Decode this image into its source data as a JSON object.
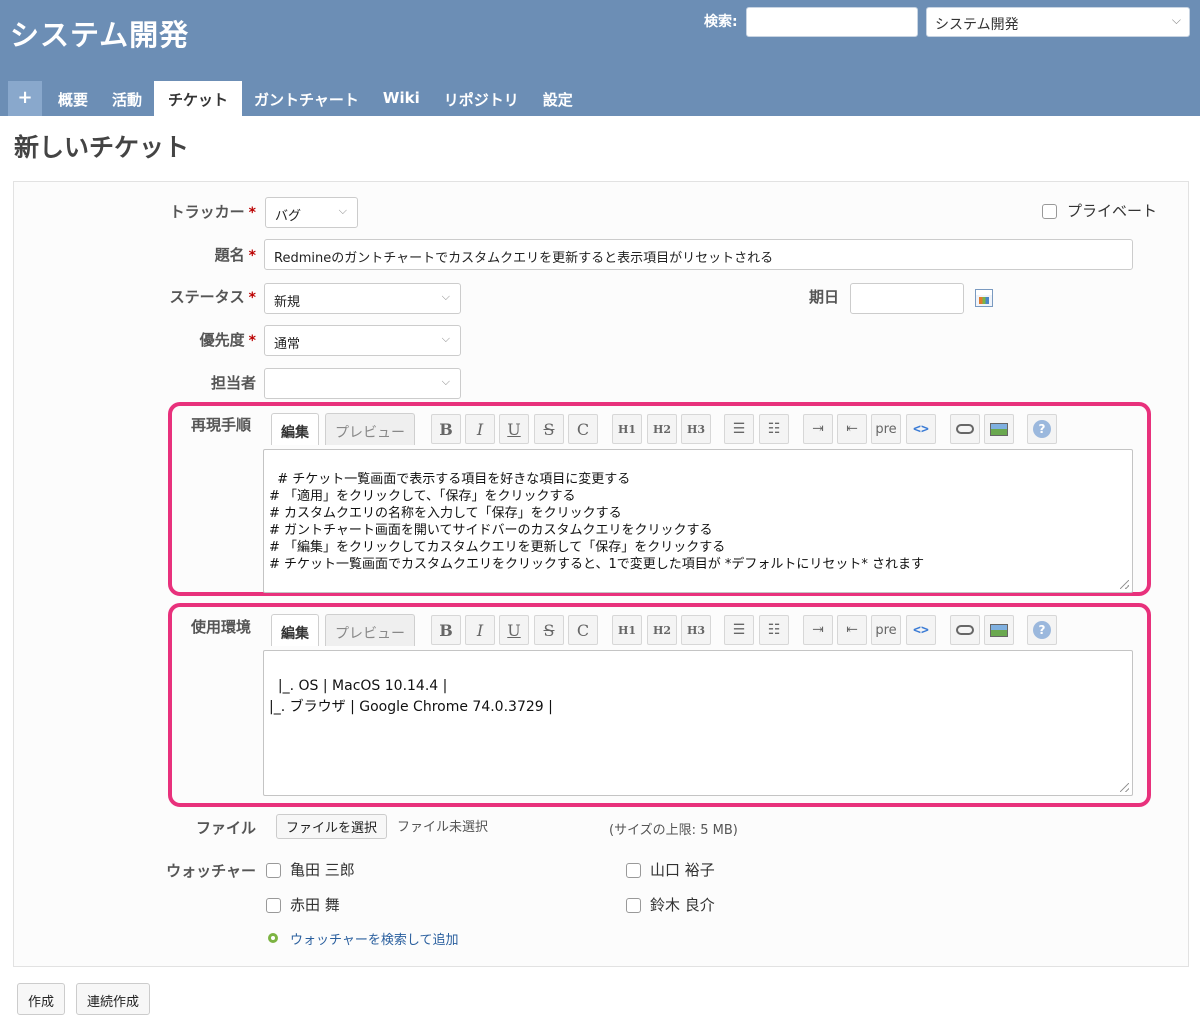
{
  "header": {
    "project_title": "システム開発",
    "search_label": "検索:",
    "search_value": "",
    "project_jump_value": "システム開発"
  },
  "menu": {
    "new_label": "+",
    "items": [
      {
        "label": "概要",
        "selected": false
      },
      {
        "label": "活動",
        "selected": false
      },
      {
        "label": "チケット",
        "selected": true
      },
      {
        "label": "ガントチャート",
        "selected": false
      },
      {
        "label": "Wiki",
        "selected": false
      },
      {
        "label": "リポジトリ",
        "selected": false
      },
      {
        "label": "設定",
        "selected": false
      }
    ]
  },
  "page": {
    "title": "新しいチケット"
  },
  "form": {
    "tracker": {
      "label": "トラッカー",
      "required_mark": "*",
      "value": "バグ"
    },
    "private": {
      "label": "プライベート",
      "checked": false
    },
    "subject": {
      "label": "題名",
      "required_mark": "*",
      "value": "Redmineのガントチャートでカスタムクエリを更新すると表示項目がリセットされる"
    },
    "status": {
      "label": "ステータス",
      "required_mark": "*",
      "value": "新規"
    },
    "due_date": {
      "label": "期日",
      "value": ""
    },
    "priority": {
      "label": "優先度",
      "required_mark": "*",
      "value": "通常"
    },
    "assignee": {
      "label": "担当者",
      "value": ""
    },
    "editor_tabs": {
      "edit": "編集",
      "preview": "プレビュー"
    },
    "toolbar": {
      "bold": "B",
      "italic": "I",
      "underline": "U",
      "strike": "S",
      "code_inline": "C",
      "h1": "H1",
      "h2": "H2",
      "h3": "H3",
      "pre": "pre",
      "code_block": "<>"
    },
    "steps": {
      "label": "再現手順",
      "value": "# チケット一覧画面で表示する項目を好きな項目に変更する\n# 「適用」をクリックして、「保存」をクリックする\n# カスタムクエリの名称を入力して「保存」をクリックする\n# ガントチャート画面を開いてサイドバーのカスタムクエリをクリックする\n# 「編集」をクリックしてカスタムクエリを更新して「保存」をクリックする\n# チケット一覧画面でカスタムクエリをクリックすると、1で変更した項目が *デフォルトにリセット* されます"
    },
    "environment": {
      "label": "使用環境",
      "value": "|_. OS | MacOS 10.14.4 |\n|_. ブラウザ | Google Chrome 74.0.3729 |"
    },
    "files": {
      "label": "ファイル",
      "choose_button": "ファイルを選択",
      "status": "ファイル未選択",
      "max_size": "(サイズの上限: 5 MB)"
    },
    "watchers": {
      "label": "ウォッチャー",
      "users": [
        {
          "name": "亀田 三郎",
          "checked": false
        },
        {
          "name": "山口 裕子",
          "checked": false
        },
        {
          "name": "赤田 舞",
          "checked": false
        },
        {
          "name": "鈴木 良介",
          "checked": false
        }
      ],
      "search_add_link": "ウォッチャーを検索して追加"
    }
  },
  "actions": {
    "create": "作成",
    "create_and_continue": "連続作成"
  },
  "colors": {
    "header_bg": "#6c8eb5",
    "highlight_border": "#e8317c",
    "required": "#bb0000",
    "link": "#2a5f9e"
  }
}
